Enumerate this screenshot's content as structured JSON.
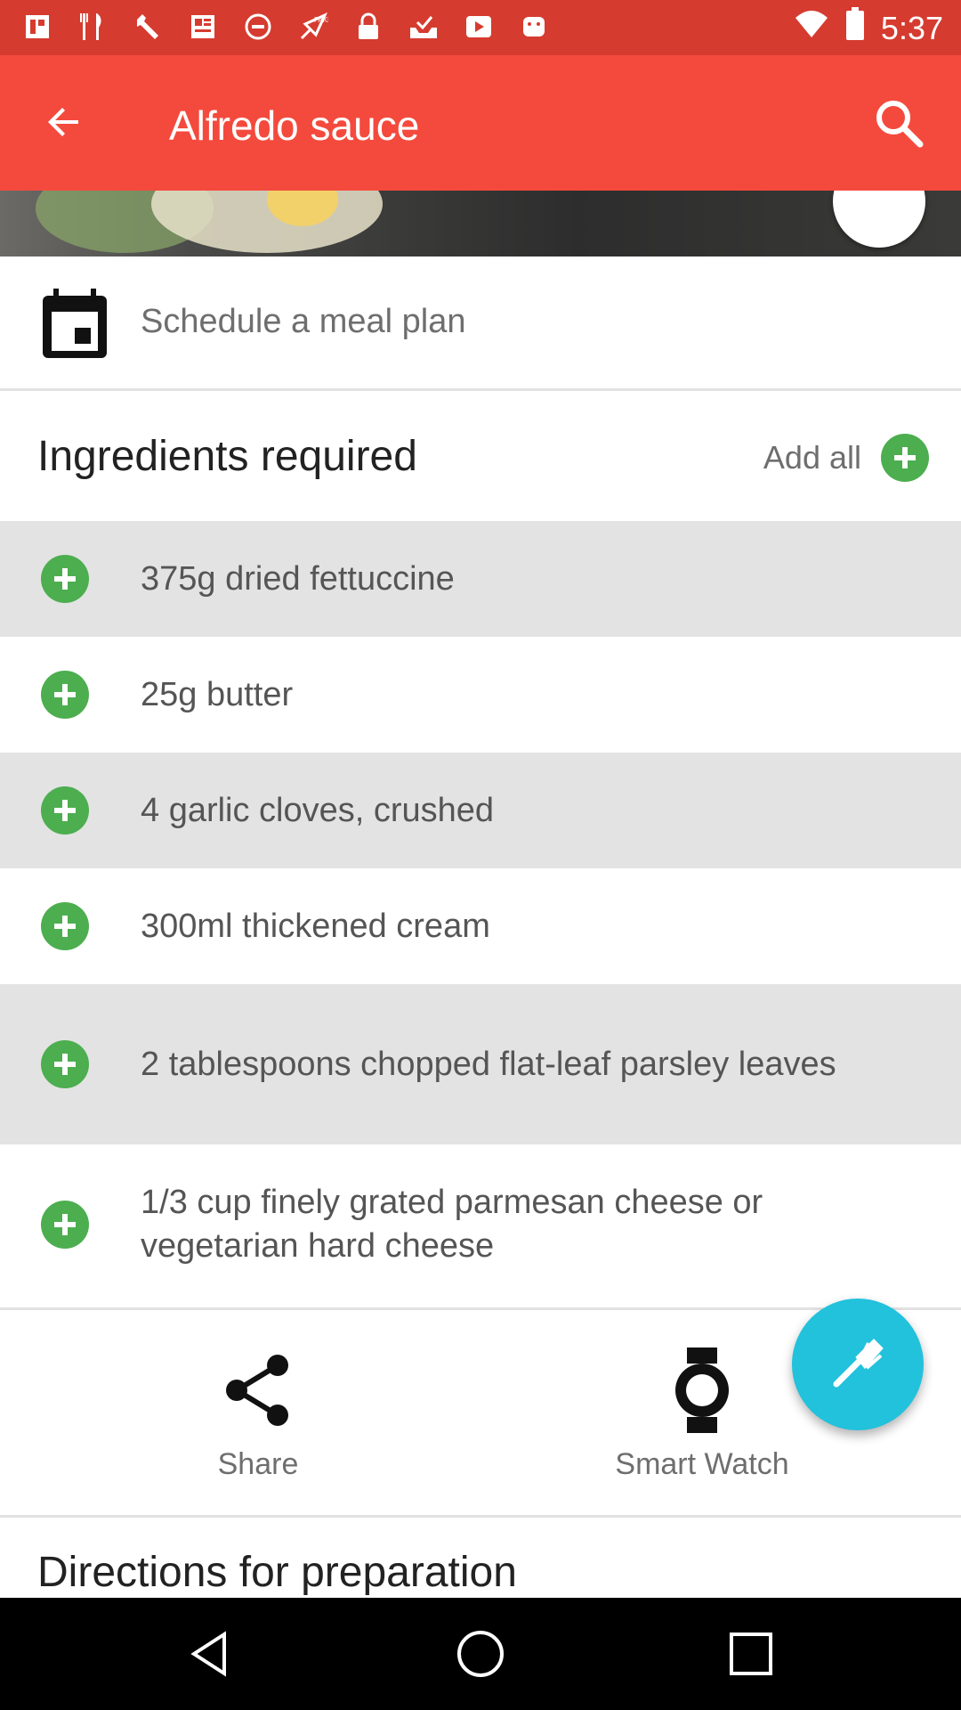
{
  "status_bar": {
    "time": "5:37",
    "icons": [
      "image-icon",
      "fork-knife-icon",
      "wrench-icon",
      "news-icon",
      "no-entry-icon",
      "fake-gps-icon",
      "lock-icon",
      "inbox-icon",
      "play-icon",
      "android-icon"
    ],
    "right_icons": [
      "wifi-icon",
      "battery-icon"
    ]
  },
  "app_bar": {
    "title": "Alfredo sauce",
    "back_icon": "arrow-back-icon",
    "search_icon": "search-icon"
  },
  "schedule": {
    "label": "Schedule a meal plan",
    "icon": "calendar-icon"
  },
  "ingredients": {
    "heading": "Ingredients required",
    "add_all_label": "Add all",
    "items": [
      {
        "text": "375g dried fettuccine",
        "shaded": true
      },
      {
        "text": "25g butter",
        "shaded": false
      },
      {
        "text": "4 garlic cloves, crushed",
        "shaded": true
      },
      {
        "text": "300ml thickened cream",
        "shaded": false
      },
      {
        "text": "2 tablespoons chopped flat-leaf parsley leaves",
        "shaded": true
      },
      {
        "text": "1/3 cup finely grated parmesan cheese or vegetarian hard cheese",
        "shaded": false
      }
    ]
  },
  "actions": {
    "share_label": "Share",
    "smartwatch_label": "Smart Watch"
  },
  "fab": {
    "icon": "fork-icon"
  },
  "directions": {
    "heading": "Directions for preparation"
  },
  "colors": {
    "status_bar": "#d63b2f",
    "app_bar": "#f44a3d",
    "add_green": "#4cae4f",
    "fab": "#22c1dc",
    "row_shade": "#e3e3e3"
  },
  "nav_bar": {
    "icons": [
      "back-triangle-icon",
      "home-circle-icon",
      "recents-square-icon"
    ]
  }
}
